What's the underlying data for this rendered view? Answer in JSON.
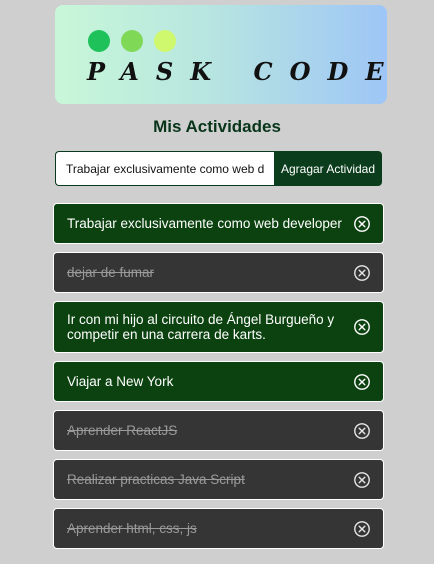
{
  "logo": {
    "text": "PASK CODE",
    "dot_colors": [
      "#1fc25a",
      "#7fd957",
      "#d0f86e"
    ]
  },
  "page_title": "Mis Actividades",
  "form": {
    "input_value": "Trabajar exclusivamente como web developer",
    "add_button_label": "Agragar Actividad"
  },
  "tasks": [
    {
      "text": "Trabajar exclusivamente como web developer",
      "completed": false
    },
    {
      "text": "dejar de fumar",
      "completed": true
    },
    {
      "text": "Ir con mi hijo al circuito de Ángel Burgueño y competir en una carrera de karts.",
      "completed": false
    },
    {
      "text": "Viajar a New York",
      "completed": false
    },
    {
      "text": "Aprender ReactJS",
      "completed": true
    },
    {
      "text": "Realizar practicas Java Script",
      "completed": true
    },
    {
      "text": "Aprender html, css, js",
      "completed": true
    }
  ],
  "icons": {
    "delete": "circle-x-icon"
  },
  "colors": {
    "background": "#cfcfcf",
    "active_item": "#0b420f",
    "done_item": "#353535",
    "accent": "#0b3d1d"
  }
}
